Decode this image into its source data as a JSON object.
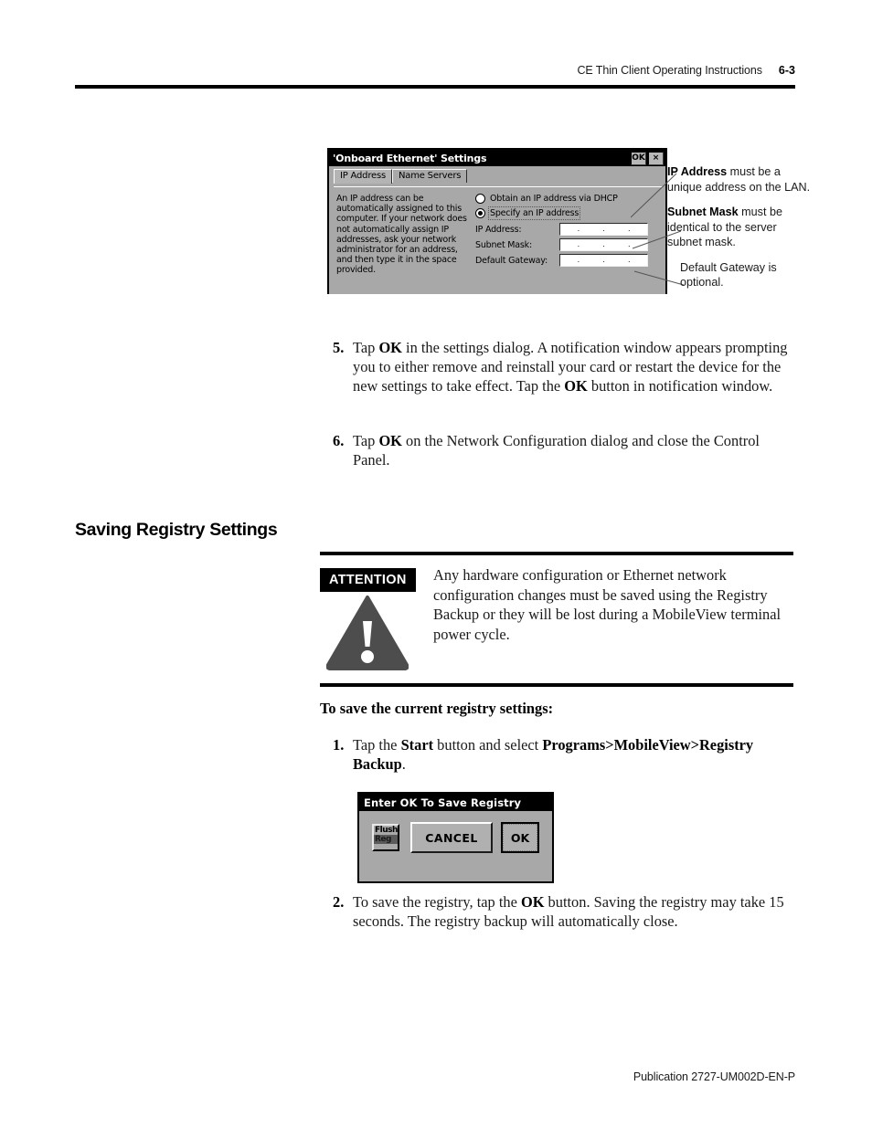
{
  "header": {
    "title": "CE Thin Client Operating Instructions",
    "page_number": "6-3"
  },
  "ethernet_dialog": {
    "title": "'Onboard Ethernet' Settings",
    "ok_button": "OK",
    "close_button": "×",
    "tabs": [
      {
        "label": "IP Address",
        "active": true
      },
      {
        "label": "Name Servers",
        "active": false
      }
    ],
    "description": "An IP address can be automatically assigned to this computer.  If your network does not automatically assign IP addresses, ask your network administrator for an address, and then type it in the space provided.",
    "radio_dhcp": "Obtain an IP address via DHCP",
    "radio_specify": "Specify an IP address",
    "selected_radio": "Specify an IP address",
    "fields": [
      {
        "label": "IP Address:",
        "value": ""
      },
      {
        "label": "Subnet Mask:",
        "value": ""
      },
      {
        "label": "Default Gateway:",
        "value": ""
      }
    ],
    "ip_separator": "."
  },
  "callouts": [
    {
      "strong": "IP Address",
      "rest": " must be a unique address on the LAN."
    },
    {
      "strong": "Subnet Mask",
      "rest": " must be identical to the server subnet mask."
    },
    {
      "strong": "",
      "rest": "Default Gateway is optional."
    }
  ],
  "steps_upper": [
    {
      "number": "5.",
      "parts": [
        {
          "t": "Tap ",
          "b": false
        },
        {
          "t": "OK",
          "b": true
        },
        {
          "t": " in the settings dialog. A notification window appears prompting you to either remove and reinstall your card or restart the device for the new settings to take effect. Tap the ",
          "b": false
        },
        {
          "t": "OK",
          "b": true
        },
        {
          "t": " button in notification window.",
          "b": false
        }
      ]
    },
    {
      "number": "6.",
      "parts": [
        {
          "t": "Tap ",
          "b": false
        },
        {
          "t": "OK",
          "b": true
        },
        {
          "t": " on the Network Configuration dialog and close the Control Panel.",
          "b": false
        }
      ]
    }
  ],
  "section": {
    "heading": "Saving Registry Settings"
  },
  "attention": {
    "label": "ATTENTION",
    "icon": "warning-triangle-exclamation",
    "text": "Any hardware configuration or Ethernet network configuration changes must be saved using the Registry Backup or they will be lost during a MobileView terminal power cycle."
  },
  "save_section": {
    "subhead": "To save the current registry settings:"
  },
  "steps_lower": [
    {
      "number": "1.",
      "parts": [
        {
          "t": "Tap the ",
          "b": false
        },
        {
          "t": "Start",
          "b": true
        },
        {
          "t": " button and select ",
          "b": false
        },
        {
          "t": "Programs>MobileView>Registry Backup",
          "b": true
        },
        {
          "t": ".",
          "b": false
        }
      ]
    },
    {
      "number": "2.",
      "parts": [
        {
          "t": "To save the registry, tap the ",
          "b": false
        },
        {
          "t": "OK",
          "b": true
        },
        {
          "t": " button. Saving the registry may take 15 seconds. The registry backup will automatically close.",
          "b": false
        }
      ]
    }
  ],
  "registry_dialog": {
    "title": "Enter OK To Save Registry",
    "icon_line1": "Flush",
    "icon_line2": "Reg",
    "cancel_label": "CANCEL",
    "ok_label": "OK"
  },
  "footer": {
    "publication": "Publication 2727-UM002D-EN-P"
  },
  "colors": {
    "ink": "#000000",
    "dialog_face": "#a8a8a8",
    "attention_bg": "#000000",
    "attention_fg": "#ffffff"
  }
}
